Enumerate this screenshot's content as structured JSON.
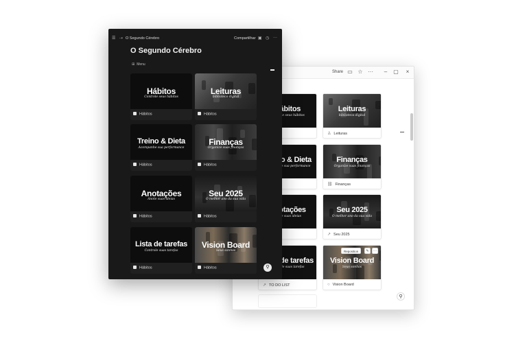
{
  "light_window": {
    "share_label": "Share",
    "icons": [
      "comment-icon",
      "star-icon",
      "more-icon",
      "minimize-icon",
      "maximize-icon",
      "close-icon"
    ],
    "reposition_label": "Reposition",
    "cards": [
      {
        "title": "Hábitos",
        "subtitle": "Controle seus hábitos",
        "caption": "",
        "icon": "none"
      },
      {
        "title": "Leituras",
        "subtitle": "biblioteca digital",
        "caption": "Leituras",
        "icon": "person-icon"
      },
      {
        "title": "Treino & Dieta",
        "subtitle": "Acompanhe sua performance",
        "caption": "Dieta",
        "icon": "none"
      },
      {
        "title": "Finanças",
        "subtitle": "Organize suas finanças",
        "caption": "Finanças",
        "icon": "link-icon"
      },
      {
        "title": "Anotações",
        "subtitle": "Anote suas ideias",
        "caption": "les",
        "icon": "none"
      },
      {
        "title": "Seu 2025",
        "subtitle": "O melhor ano da sua vida",
        "caption": "Seu 2025",
        "icon": "arrow-icon"
      },
      {
        "title": "Lista de tarefas",
        "subtitle": "Controle suas tarefas",
        "caption": "TO DO LIST",
        "icon": "arrow-icon"
      },
      {
        "title": "Vision Board",
        "subtitle": "Seus sonhos",
        "caption": "Vision Board",
        "icon": "circle-icon"
      }
    ]
  },
  "dark_window": {
    "breadcrumb": "O Segundo Cérebro",
    "share_label": "Compartilhar",
    "page_title": "O Segundo Cérebro",
    "menu_label": "Menu",
    "cards": [
      {
        "title": "Hábitos",
        "subtitle": "Controle seus hábitos",
        "caption": "Hábitos"
      },
      {
        "title": "Leituras",
        "subtitle": "biblioteca digital",
        "caption": "Hábitos"
      },
      {
        "title": "Treino & Dieta",
        "subtitle": "Acompanhe sua performance",
        "caption": "Hábitos"
      },
      {
        "title": "Finanças",
        "subtitle": "Organize suas finanças",
        "caption": "Hábitos"
      },
      {
        "title": "Anotações",
        "subtitle": "Anote suas ideias",
        "caption": "Hábitos"
      },
      {
        "title": "Seu 2025",
        "subtitle": "O melhor ano da sua vida",
        "caption": "Hábitos"
      },
      {
        "title": "Lista de tarefas",
        "subtitle": "Controle suas tarefas",
        "caption": "Hábitos"
      },
      {
        "title": "Vision Board",
        "subtitle": "Seus sonhos",
        "caption": "Hábitos"
      }
    ]
  },
  "colors": {
    "dark_bg": "#191919",
    "card_dark": "#202020",
    "light_bg": "#ffffff"
  }
}
